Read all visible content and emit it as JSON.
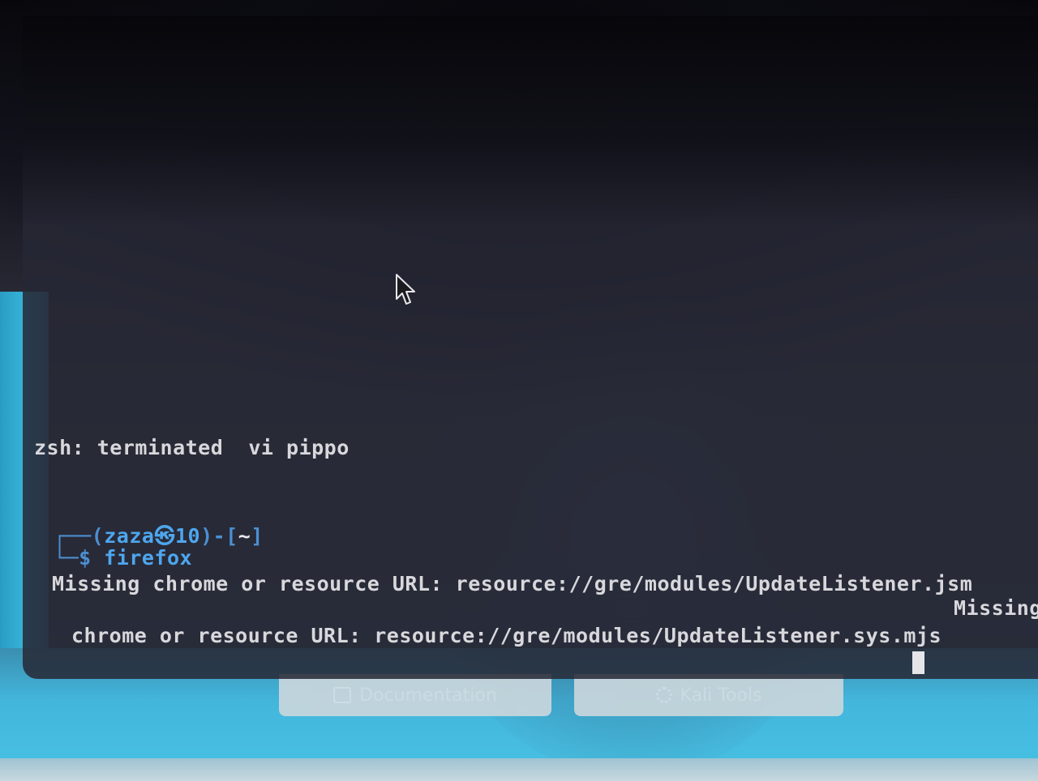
{
  "launchers": {
    "documentation": {
      "label": "Documentation",
      "icon": "document-icon"
    },
    "kali_tools": {
      "label": "Kali Tools",
      "icon": "gear-icon"
    }
  },
  "terminal": {
    "termination_message": "zsh: terminated  vi pippo",
    "prompt": {
      "user": "zaza",
      "at": "㉿",
      "host": "10",
      "cwd": "~",
      "symbol": "$",
      "command": "firefox"
    },
    "output": [
      "Missing chrome or resource URL: resource://gre/modules/UpdateListener.jsm",
      "Missing",
      "chrome or resource URL: resource://gre/modules/UpdateListener.sys.mjs"
    ]
  },
  "colors": {
    "prompt_blue": "#4ea6ee",
    "terminal_text": "#d8d8dc",
    "wallpaper_accent": "#43b6dc"
  }
}
